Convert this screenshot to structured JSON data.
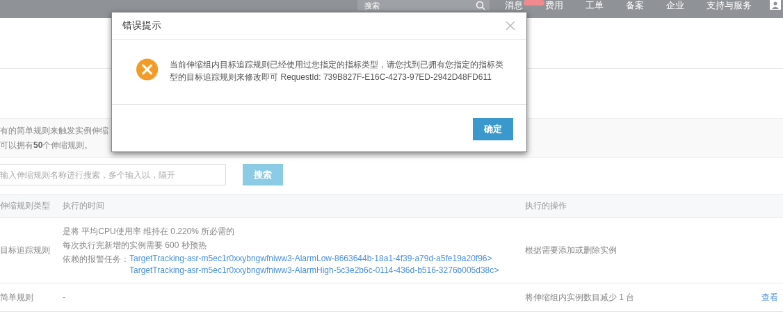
{
  "topbar": {
    "search": {
      "placeholder": "搜索"
    },
    "items": [
      {
        "label": "消息",
        "badge": true
      },
      {
        "label": "费用",
        "badge": false
      },
      {
        "label": "工单",
        "badge": false
      },
      {
        "label": "备案",
        "badge": false
      },
      {
        "label": "企业",
        "badge": false
      },
      {
        "label": "支持与服务",
        "badge": false
      }
    ]
  },
  "notice": [
    "有的简单规则来触发实例伸缩",
    "可以拥有**50**个伸缩规则。"
  ],
  "search": {
    "placeholder": "输入伸缩规则名称进行搜索，多个输入以，隔开",
    "button": "搜索"
  },
  "table": {
    "columns": [
      "伸缩规则类型",
      "执行的时间",
      "执行的操作"
    ],
    "rows": [
      {
        "type": "目标追踪规则",
        "time_lines": [
          "是将 平均CPU使用率 维持在 0.220% 所必需的",
          "每次执行完新增的实例需要 600 秒预热"
        ],
        "alarm_label": "依赖的报警任务：",
        "alarms": [
          "TargetTracking-asr-m5ec1r0xxybngwfniww3-AlarmLow-8663644b-18a1-4f39-a79d-a5fe19a20f96>",
          "TargetTracking-asr-m5ec1r0xxybngwfniww3-AlarmHigh-5c3e2b6c-0114-436d-b516-3276b005d38c>"
        ],
        "action": "根据需要添加或删除实例"
      },
      {
        "type": "简单规则",
        "time_lines": [
          "-"
        ],
        "alarms": [],
        "action": "将伸缩组内实例数目减少 1 台",
        "link": "查看"
      }
    ]
  },
  "dialog": {
    "title": "错误提示",
    "message": "当前伸缩组内目标追踪规则已经使用过您指定的指标类型，请您找到已拥有您指定的指标类型的目标追踪规则来修改即可 RequestId: 739B827F-E16C-4273-97ED-2942D48FD611",
    "ok": "确定"
  }
}
